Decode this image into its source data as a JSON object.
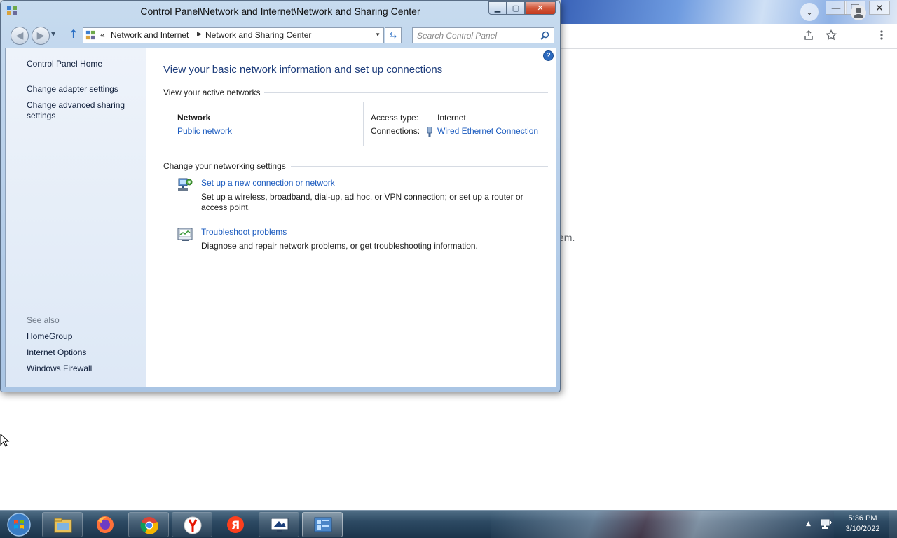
{
  "window": {
    "title": "Control Panel\\Network and Internet\\Network and Sharing Center",
    "caption": {
      "minimize": "▁",
      "maximize": "▢",
      "close": "✕"
    }
  },
  "navigation": {
    "back_icon": "back-arrow-icon",
    "forward_icon": "forward-arrow-icon",
    "overflow": "«",
    "breadcrumbs": [
      "Network and Internet",
      "Network and Sharing Center"
    ],
    "separator": "▶",
    "search_placeholder": "Search Control Panel"
  },
  "sidebar": {
    "home": "Control Panel Home",
    "links": [
      "Change adapter settings",
      "Change advanced sharing settings"
    ],
    "see_also_label": "See also",
    "see_also": [
      "HomeGroup",
      "Internet Options",
      "Windows Firewall"
    ]
  },
  "main": {
    "title": "View your basic network information and set up connections",
    "active_networks_heading": "View your active networks",
    "network": {
      "name": "Network",
      "type": "Public network",
      "access_type_label": "Access type:",
      "access_type_value": "Internet",
      "connections_label": "Connections:",
      "connections_value": "Wired Ethernet Connection"
    },
    "change_settings_heading": "Change your networking settings",
    "tasks": [
      {
        "link": "Set up a new connection or network",
        "desc": "Set up a wireless, broadband, dial-up, ad hoc, or VPN connection; or set up a router or access point."
      },
      {
        "link": "Troubleshoot problems",
        "desc": "Diagnose and repair network problems, or get troubleshooting information."
      }
    ],
    "help": "?"
  },
  "browser": {
    "tab_dropdown": "⌄",
    "caption": {
      "minimize": "—",
      "restore": "❐",
      "close": "✕"
    },
    "fragment_text": "em."
  },
  "taskbar": {
    "items": [
      "file-explorer",
      "firefox",
      "chrome",
      "yandex-browser",
      "yandex",
      "remote-desktop",
      "control-panel"
    ],
    "time": "5:36 PM",
    "date": "3/10/2022",
    "tray_arrow": "▲"
  },
  "colors": {
    "link": "#1b5bbf",
    "title_blue": "#1f3e7c",
    "taskbar": "#2d4a63"
  }
}
